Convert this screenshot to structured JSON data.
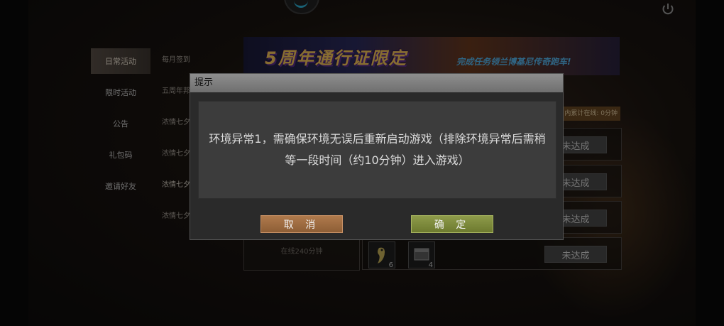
{
  "tabs": [
    "日常活动",
    "限时活动",
    "公告",
    "礼包码",
    "邀请好友"
  ],
  "subtabs": [
    "每月签到",
    "五周年邦",
    "浓情七夕",
    "浓情七夕",
    "浓情七夕",
    "浓情七夕"
  ],
  "banner": {
    "title": "5周年通行证限定",
    "subtitle": "完成任务领兰博基尼传奇跑车!"
  },
  "online_tag": "内累计在线: 0分钟",
  "rows": [
    {
      "status": "未达成"
    },
    {
      "status": "未达成"
    },
    {
      "status": "未达成"
    },
    {
      "status": "未达成"
    }
  ],
  "left_card": "在线240分钟",
  "items": [
    {
      "icon": "parrot-icon",
      "count": "6"
    },
    {
      "icon": "crate-icon",
      "count": "4"
    }
  ],
  "dialog": {
    "title": "提示",
    "message": "环境异常1，需确保环境无误后重新启动游戏（排除环境异常后需稍等一段时间（约10分钟）进入游戏）",
    "cancel": "取 消",
    "ok": "确 定"
  }
}
